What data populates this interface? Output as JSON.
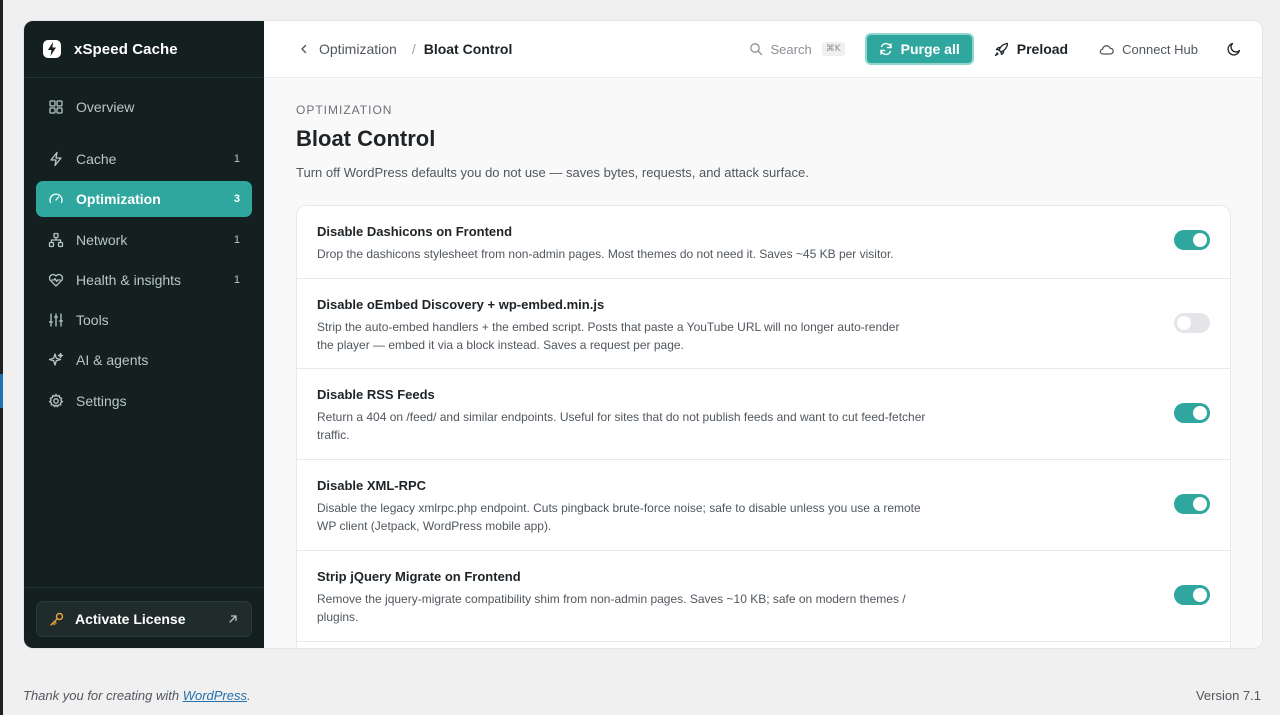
{
  "brand": {
    "name": "xSpeed Cache"
  },
  "sidebar": {
    "items": [
      {
        "label": "Overview",
        "count": ""
      },
      {
        "label": "Cache",
        "count": "1"
      },
      {
        "label": "Optimization",
        "count": "3"
      },
      {
        "label": "Network",
        "count": "1"
      },
      {
        "label": "Health & insights",
        "count": "1"
      },
      {
        "label": "Tools",
        "count": ""
      },
      {
        "label": "AI & agents",
        "count": ""
      },
      {
        "label": "Settings",
        "count": ""
      }
    ],
    "active_index": 2,
    "license_label": "Activate License"
  },
  "topbar": {
    "breadcrumb_parent": "Optimization",
    "breadcrumb_separator": "/",
    "breadcrumb_current": "Bloat Control",
    "search_label": "Search",
    "search_shortcut": "⌘K",
    "purge_label": "Purge all",
    "preload_label": "Preload",
    "connect_label": "Connect Hub"
  },
  "page": {
    "eyebrow": "OPTIMIZATION",
    "title": "Bloat Control",
    "description": "Turn off WordPress defaults you do not use — saves bytes, requests, and attack surface."
  },
  "settings": [
    {
      "title": "Disable Dashicons on Frontend",
      "description": "Drop the dashicons stylesheet from non-admin pages. Most themes do not need it. Saves ~45 KB per visitor.",
      "enabled": true
    },
    {
      "title": "Disable oEmbed Discovery + wp-embed.min.js",
      "description": "Strip the auto-embed handlers + the embed script. Posts that paste a YouTube URL will no longer auto-render the player — embed it via a block instead. Saves a request per page.",
      "enabled": false
    },
    {
      "title": "Disable RSS Feeds",
      "description": "Return a 404 on /feed/ and similar endpoints. Useful for sites that do not publish feeds and want to cut feed-fetcher traffic.",
      "enabled": true
    },
    {
      "title": "Disable XML-RPC",
      "description": "Disable the legacy xmlrpc.php endpoint. Cuts pingback brute-force noise; safe to disable unless you use a remote WP client (Jetpack, WordPress mobile app).",
      "enabled": true
    },
    {
      "title": "Strip jQuery Migrate on Frontend",
      "description": "Remove the jquery-migrate compatibility shim from non-admin pages. Saves ~10 KB; safe on modern themes / plugins.",
      "enabled": true
    }
  ],
  "footer": {
    "thanks_prefix": "Thank you for creating with ",
    "thanks_link": "WordPress",
    "thanks_suffix": ".",
    "version": "Version 7.1"
  },
  "colors": {
    "accent": "#2fa79e",
    "sidebar_bg": "#13201f",
    "license_icon": "#e8a33a"
  },
  "icons": {
    "brand": "lightning-logo-icon",
    "nav": [
      "grid-icon",
      "bolt-icon",
      "gauge-icon",
      "network-icon",
      "heart-pulse-icon",
      "sliders-icon",
      "sparkles-icon",
      "gear-icon"
    ],
    "license": "key-icon",
    "search": "search-icon",
    "purge": "refresh-icon",
    "preload": "rocket-icon",
    "connect": "cloud-icon",
    "theme": "moon-icon"
  }
}
